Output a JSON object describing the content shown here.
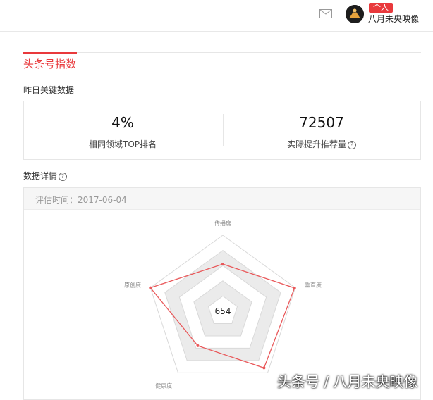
{
  "header": {
    "badge": "个人",
    "username": "八月未央映像",
    "mail_icon": "mail-icon"
  },
  "section_title": "头条号指数",
  "yesterday": {
    "heading": "昨日关键数据",
    "kpis": [
      {
        "value": "4%",
        "label": "相同领域TOP排名"
      },
      {
        "value": "72507",
        "label": "实际提升推荐量"
      }
    ]
  },
  "details": {
    "heading": "数据详情",
    "eval_time": "评估时间：2017-06-04"
  },
  "chart_data": {
    "type": "radar",
    "axes": [
      "传播度",
      "垂直度",
      "",
      "健康度",
      "原创度"
    ],
    "values": [
      0.62,
      0.99,
      0.92,
      0.56,
      1.0
    ],
    "center_label": "654",
    "range": [
      0,
      1
    ],
    "colors": {
      "line": "#e9585a",
      "band": "#ebebeb",
      "grid": "#d9d9d9"
    }
  },
  "watermark": "头条号 / 八月未央映像"
}
